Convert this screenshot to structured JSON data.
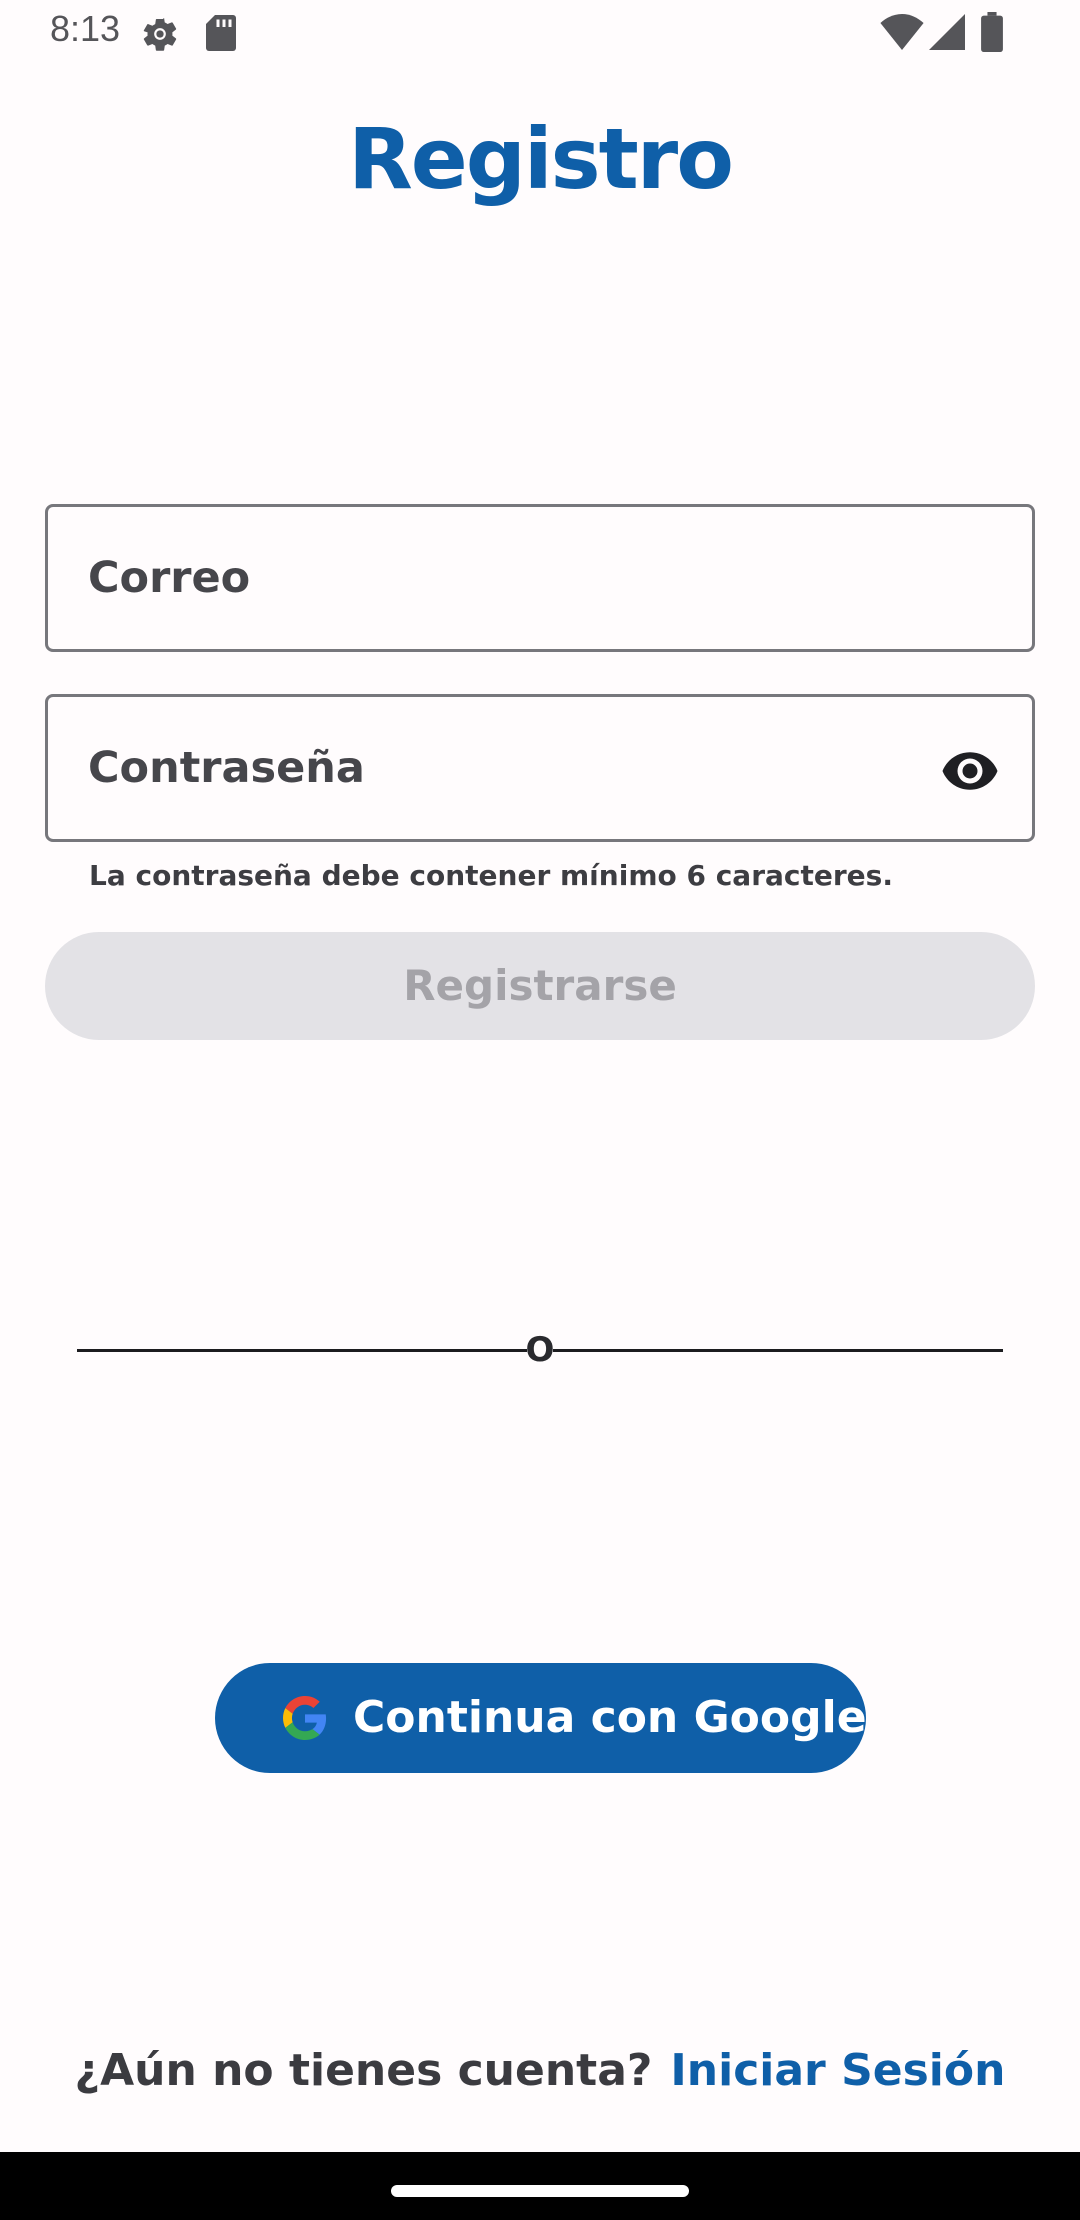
{
  "status_bar": {
    "time": "8:13",
    "icons": [
      "settings-icon",
      "sd-card-icon",
      "wifi-icon",
      "signal-icon",
      "battery-icon"
    ]
  },
  "title": "Registro",
  "email_field": {
    "placeholder": "Correo",
    "value": ""
  },
  "password_field": {
    "placeholder": "Contraseña",
    "value": "",
    "toggle_icon": "eye-icon",
    "helper": "La contraseña debe contener mínimo 6 caracteres."
  },
  "register_button": {
    "label": "Registrarse",
    "enabled": false
  },
  "divider": {
    "text": "O"
  },
  "google_button": {
    "label": "Continua con Google",
    "icon": "google-logo-icon"
  },
  "footer": {
    "prompt": "¿Aún no tienes cuenta?",
    "link": "Iniciar Sesión"
  },
  "colors": {
    "primary": "#0f5fa8",
    "background": "#fffcfd",
    "disabled_button": "#e3e2e6",
    "disabled_text": "#a4a3a8"
  }
}
